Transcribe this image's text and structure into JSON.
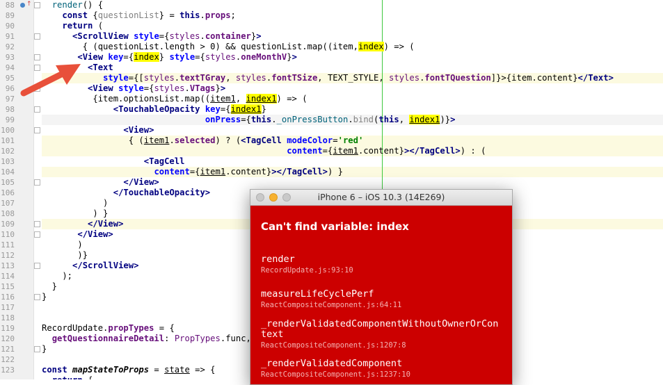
{
  "editor": {
    "line_numbers": [
      "88",
      "89",
      "90",
      "91",
      "92",
      "93",
      "94",
      "95",
      "96",
      "97",
      "98",
      "99",
      "100",
      "101",
      "102",
      "103",
      "104",
      "105",
      "106",
      "107",
      "108",
      "109",
      "110",
      "111",
      "112",
      "113",
      "114",
      "115",
      "116",
      "117",
      "118",
      "119",
      "120",
      "121",
      "122",
      "123"
    ],
    "colors": {
      "highlight_line": "#fcfae0",
      "current_line": "#f4f4f4",
      "search_match": "#ffff00",
      "right_margin": "#3cc83c"
    }
  },
  "arrow": {
    "color": "#e8503a"
  },
  "simulator": {
    "title": "iPhone 6 – iOS 10.3 (14E269)",
    "error_message": "Can't find variable: index",
    "error_color": "#cc0000",
    "frames": [
      {
        "function": "render",
        "location": "RecordUpdate.js:93:10"
      },
      {
        "function": "measureLifeCyclePerf",
        "location": "ReactCompositeComponent.js:64:11"
      },
      {
        "function": "_renderValidatedComponentWithoutOwnerOrContext",
        "location": "ReactCompositeComponent.js:1207:8"
      },
      {
        "function": "_renderValidatedComponent",
        "location": "ReactCompositeComponent.js:1237:10"
      }
    ]
  }
}
